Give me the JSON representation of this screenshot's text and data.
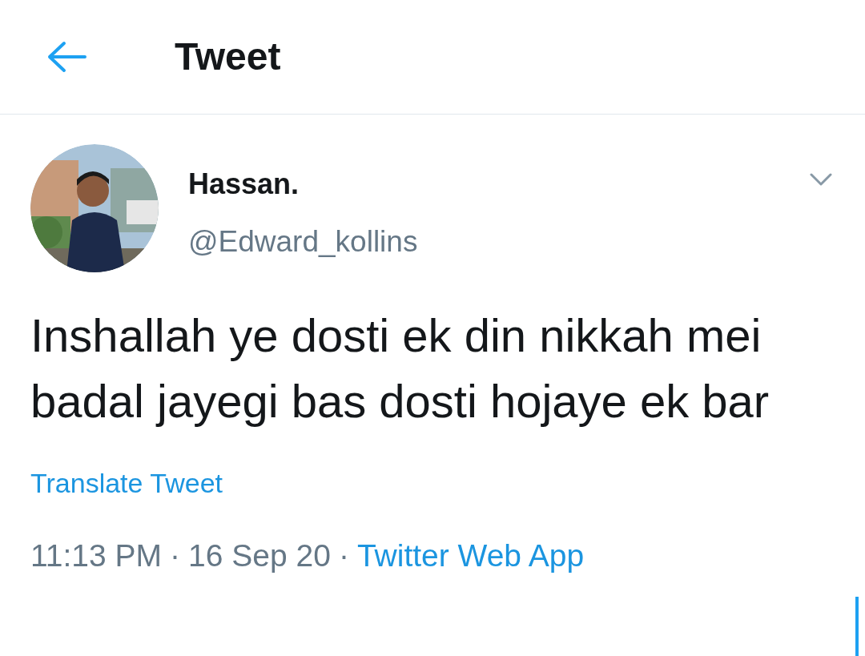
{
  "header": {
    "title": "Tweet"
  },
  "tweet": {
    "author": {
      "name": "Hassan.",
      "handle": "@Edward_kollins"
    },
    "text": "Inshallah ye dosti ek din nikkah mei badal jayegi bas dosti hojaye ek bar",
    "translate_link": "Translate Tweet",
    "time": "11:13 PM",
    "separator_1": "·",
    "date": "16 Sep 20",
    "separator_2": "·",
    "source": "Twitter Web App"
  }
}
